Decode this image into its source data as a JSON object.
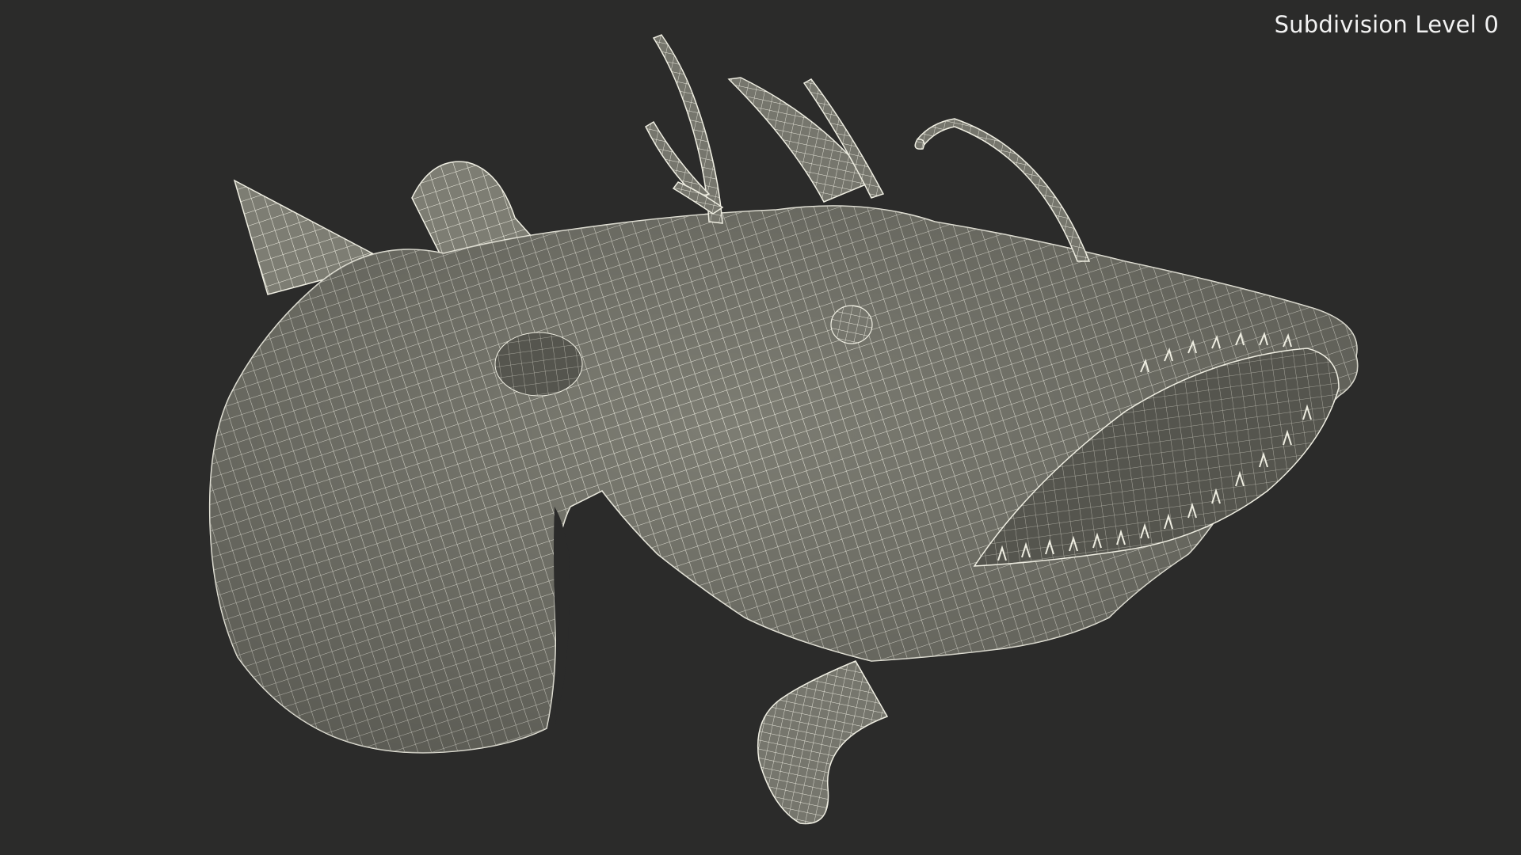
{
  "viewport": {
    "overlay_label": "Subdivision Level 0",
    "background_color": "#2b2b2a"
  },
  "model": {
    "subject": "anglerfish-wireframe",
    "surface_color": "#7d7d73",
    "wire_color": "#efeee2",
    "mouth_interior_color": "#55554e"
  }
}
